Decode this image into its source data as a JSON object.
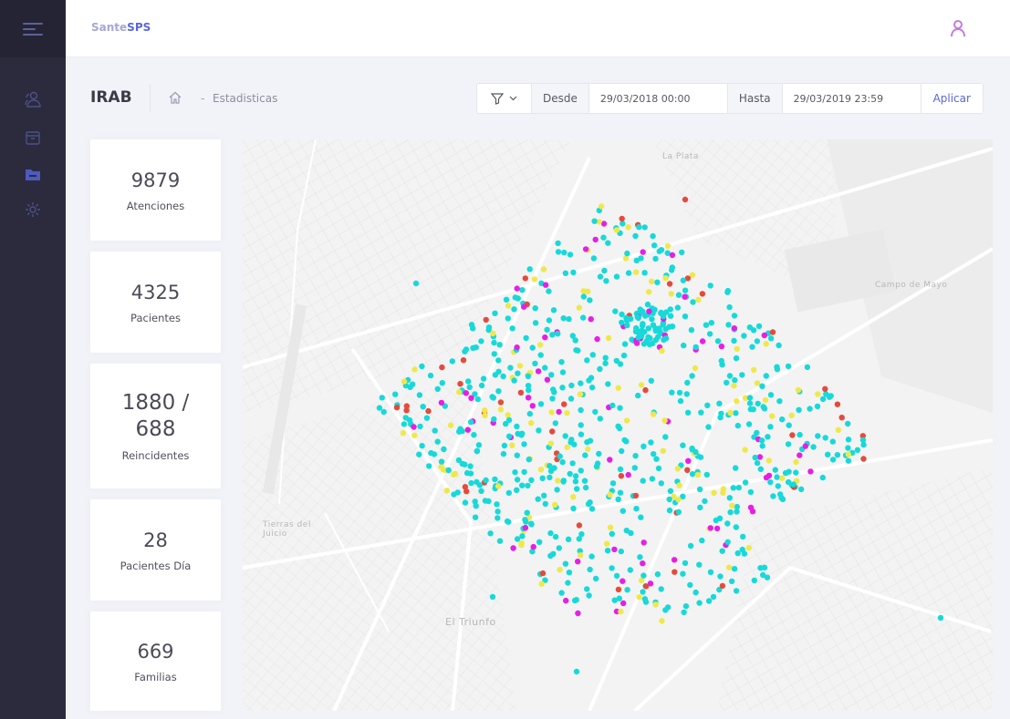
{
  "header": {
    "brand_prefix": "Sante",
    "brand_suffix": "SPS"
  },
  "subheader": {
    "title": "IRAB",
    "breadcrumb_dash": "-",
    "breadcrumb": "Estadisticas"
  },
  "filter": {
    "from_label": "Desde",
    "from_value": "29/03/2018 00:00",
    "to_label": "Hasta",
    "to_value": "29/03/2019 23:59",
    "apply_label": "Aplicar"
  },
  "stats": [
    {
      "value": "9879",
      "label": "Atenciones"
    },
    {
      "value": "4325",
      "label": "Pacientes"
    },
    {
      "value": "1880 / 688",
      "label": "Reincidentes"
    },
    {
      "value": "28",
      "label": "Pacientes Día"
    },
    {
      "value": "669",
      "label": "Familias"
    }
  ],
  "map": {
    "labels": [
      "La Plata",
      "Campo de Mayo",
      "Tierras del Juicio",
      "El Triunfo"
    ],
    "colors": {
      "cyan": "#17d9d9",
      "yellow": "#efe84b",
      "magenta": "#e61ee6",
      "red": "#e34b3c"
    }
  },
  "colors": {
    "sidebar": "#2b2b3d",
    "accent": "#5867dd",
    "user": "#c47be0"
  },
  "icons": {
    "menu": "hamburger-icon",
    "users": "users-icon",
    "box": "box-icon",
    "folder": "folder-icon",
    "settings": "gear-icon",
    "home": "home-icon",
    "filter": "filter-icon",
    "user": "user-icon"
  }
}
